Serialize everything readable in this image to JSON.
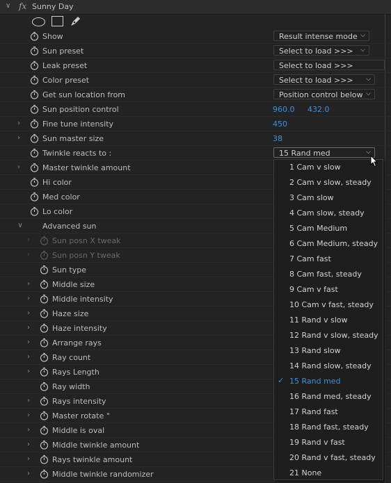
{
  "effect": {
    "title": "Sunny Day",
    "fx_label": "fx"
  },
  "mask_tools": [
    "ellipse-mask-icon",
    "rectangle-mask-icon",
    "pen-mask-icon"
  ],
  "params": {
    "show": {
      "label": "Show",
      "value": "Result intense mode"
    },
    "sun_preset": {
      "label": "Sun preset",
      "value": "Select to load >>>"
    },
    "leak_preset": {
      "label": "Leak preset",
      "value": "Select to load >>>"
    },
    "color_preset": {
      "label": "Color preset",
      "value": "Select to load >>>"
    },
    "get_sun_location": {
      "label": "Get sun location from",
      "value": "Position control below"
    },
    "sun_position_control": {
      "label": "Sun position control",
      "x": "960.0",
      "y": "432.0"
    },
    "fine_tune_intensity": {
      "label": "Fine tune intensity",
      "value": "450"
    },
    "sun_master_size": {
      "label": "Sun master size",
      "value": "38"
    },
    "twinkle_reacts_to": {
      "label": "Twinkle reacts to :",
      "value": "15 Rand med"
    },
    "master_twinkle_amount": {
      "label": "Master twinkle amount"
    },
    "hi_color": {
      "label": "Hi color"
    },
    "med_color": {
      "label": "Med color"
    },
    "lo_color": {
      "label": "Lo color"
    },
    "advanced_sun": {
      "label": "Advanced sun"
    },
    "sun_posn_x_tweak": {
      "label": "Sun posn X tweak"
    },
    "sun_posn_y_tweak": {
      "label": "Sun posn Y tweak"
    },
    "sun_type": {
      "label": "Sun type"
    },
    "middle_size": {
      "label": "Middle size"
    },
    "middle_intensity": {
      "label": "Middle intensity"
    },
    "haze_size": {
      "label": "Haze size"
    },
    "haze_intensity": {
      "label": "Haze intensity"
    },
    "arrange_rays": {
      "label": "Arrange rays"
    },
    "ray_count": {
      "label": "Ray count"
    },
    "rays_length": {
      "label": "Rays Length"
    },
    "ray_width": {
      "label": "Ray width"
    },
    "rays_intensity": {
      "label": "Rays intensity"
    },
    "master_rotate": {
      "label": "Master rotate °"
    },
    "middle_is_oval": {
      "label": "Middle is oval"
    },
    "middle_twinkle_amount": {
      "label": "Middle twinkle amount"
    },
    "rays_twinkle_amount": {
      "label": "Rays twinkle amount"
    },
    "middle_twinkle_randomizer": {
      "label": "Middle twinkle randomizer"
    }
  },
  "dropdown_menu": {
    "selected": "15 Rand med",
    "items": [
      "1 Cam v slow",
      "2 Cam v slow, steady",
      "3 Cam slow",
      "4 Cam slow, steady",
      "5 Cam Medium",
      "6 Cam Medium, steady",
      "7 Cam fast",
      "8 Cam fast, steady",
      "9 Cam v fast",
      "10 Cam v fast, steady",
      "11 Rand v slow",
      "12 Rand v slow, steady",
      "13 Rand slow",
      "14 Rand slow, steady",
      "15 Rand med",
      "16 Rand med, steady",
      "17 Rand fast",
      "18 Rand fast, steady",
      "19 Rand v fast",
      "20 Rand v fast, steady",
      "21 None"
    ]
  },
  "colors": {
    "accent_blue": "#3f8fdc",
    "panel_bg": "#232323",
    "menu_bg": "#1e1e1e"
  }
}
